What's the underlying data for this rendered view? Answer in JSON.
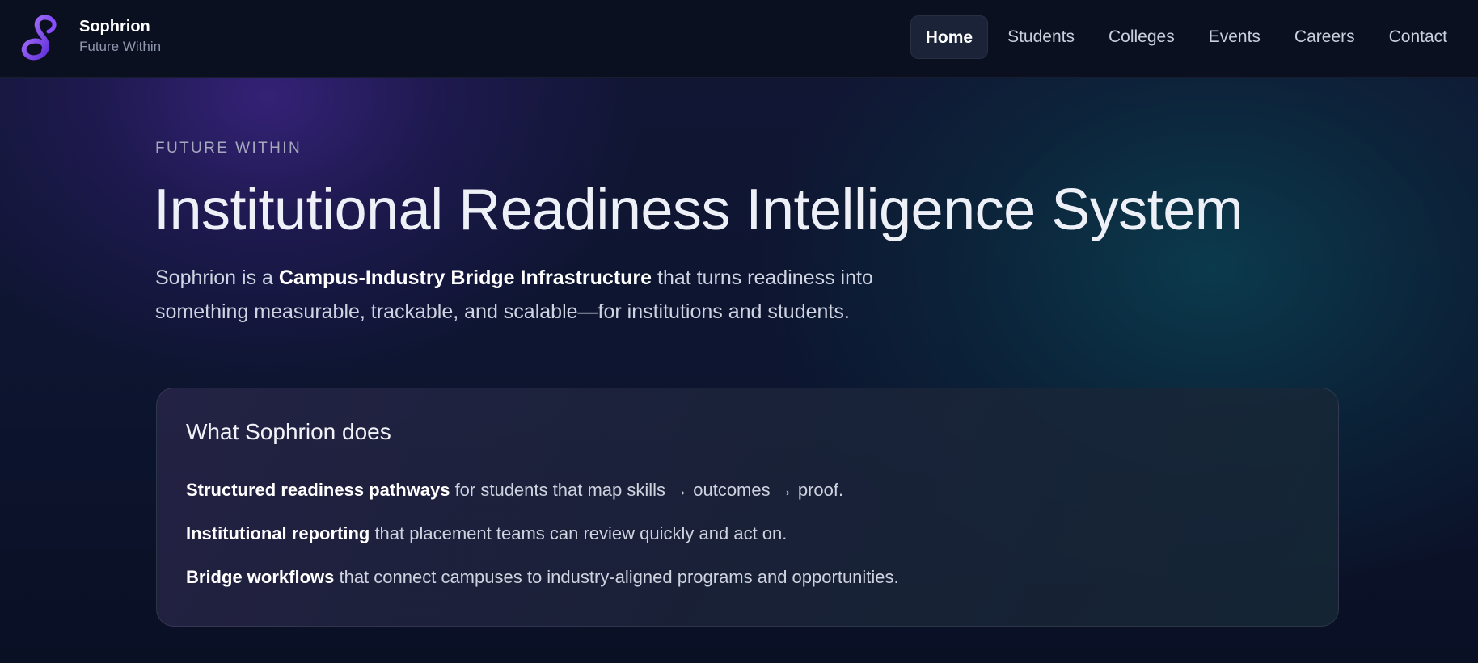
{
  "brand": {
    "name": "Sophrion",
    "tagline": "Future Within",
    "logo_icon": "infinity-s-logo-icon",
    "logo_colors": [
      "#5b2bd8",
      "#9b5cff"
    ]
  },
  "nav": {
    "items": [
      {
        "label": "Home",
        "active": true
      },
      {
        "label": "Students",
        "active": false
      },
      {
        "label": "Colleges",
        "active": false
      },
      {
        "label": "Events",
        "active": false
      },
      {
        "label": "Careers",
        "active": false
      },
      {
        "label": "Contact",
        "active": false
      }
    ]
  },
  "hero": {
    "eyebrow": "FUTURE WITHIN",
    "title": "Institutional Readiness Intelligence System",
    "desc_prefix": "Sophrion is a ",
    "desc_bold": "Campus-Industry Bridge Infrastructure",
    "desc_suffix": " that turns readiness into something measurable, trackable, and scalable—for institutions and students."
  },
  "card": {
    "title": "What Sophrion does",
    "items": [
      {
        "bold": "Structured readiness pathways",
        "text": " for students that map skills → outcomes → proof."
      },
      {
        "bold": "Institutional reporting",
        "text": " that placement teams can review quickly and act on."
      },
      {
        "bold": "Bridge workflows",
        "text": " that connect campuses to industry-aligned programs and opportunities."
      }
    ]
  },
  "colors": {
    "background": "#0a1020",
    "navbar": "#0b1021",
    "active_nav": "#1a2337",
    "accent_purple": "#9b5cff"
  }
}
